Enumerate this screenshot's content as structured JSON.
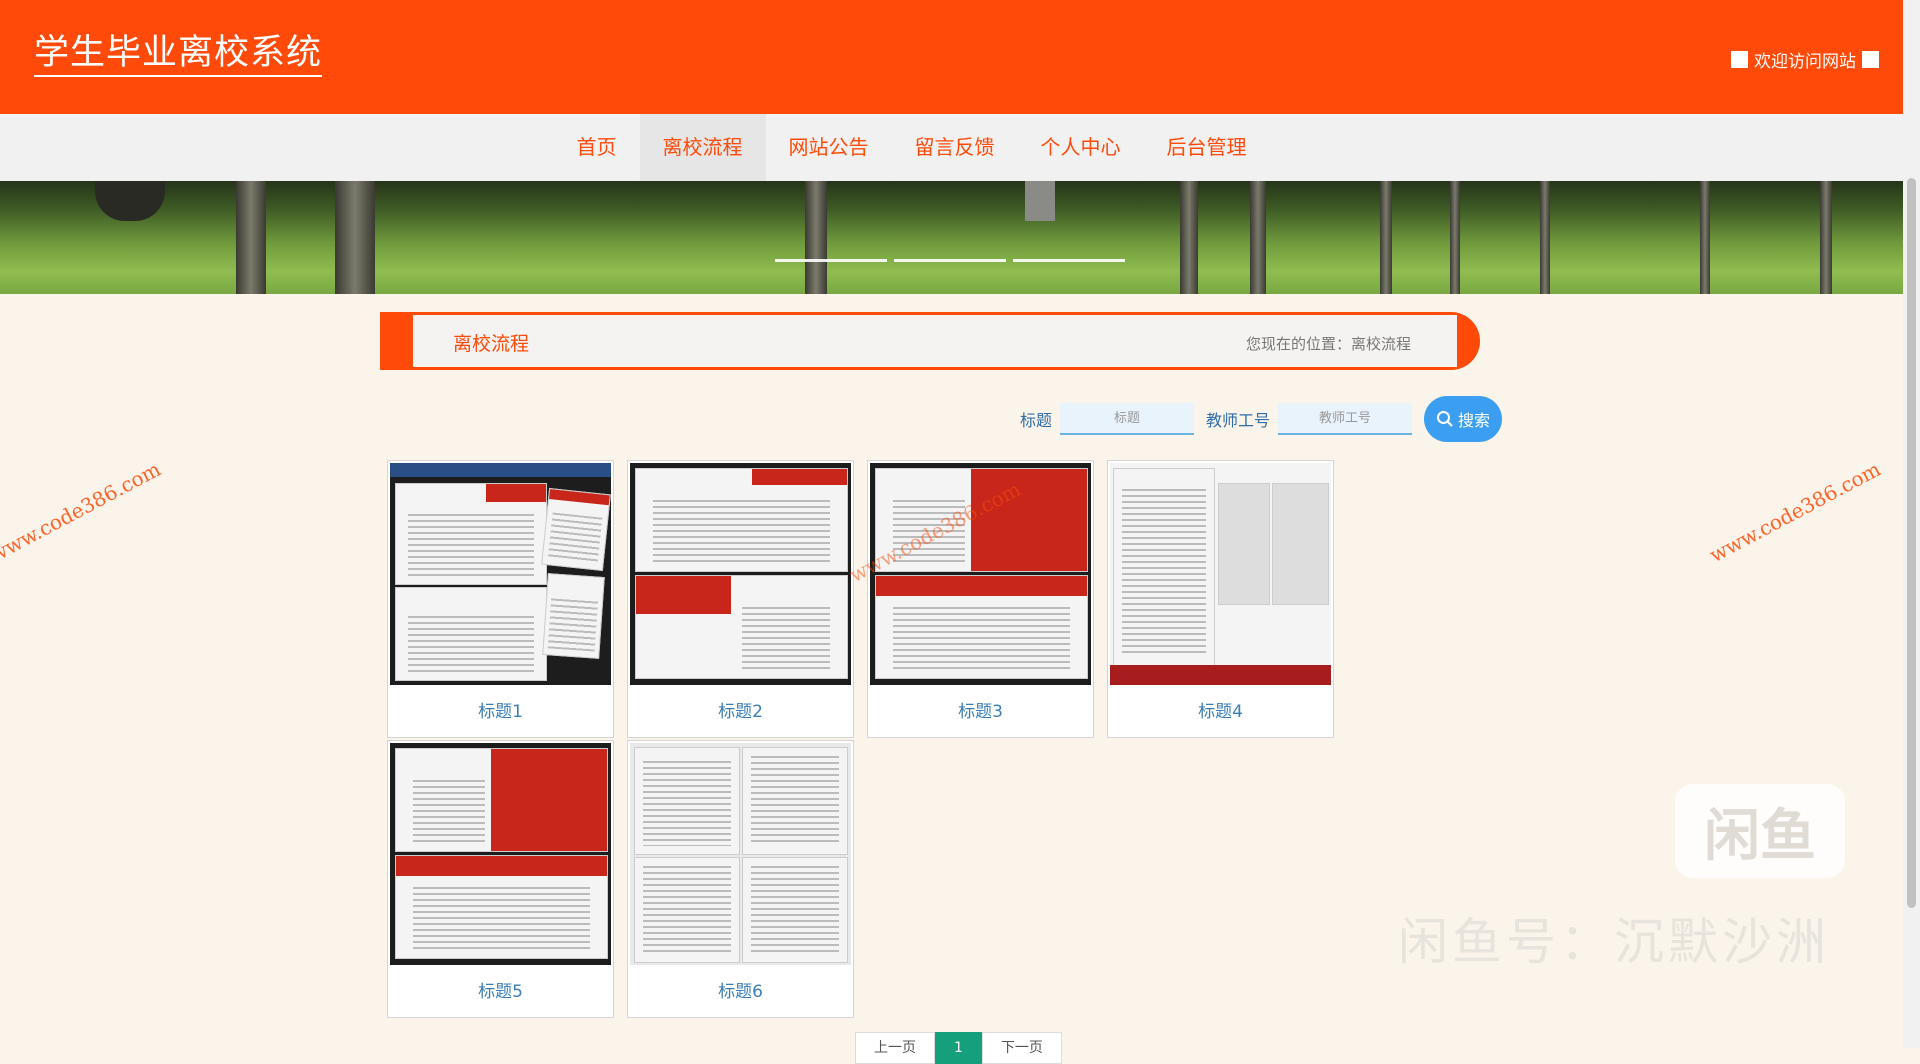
{
  "header": {
    "title": "学生毕业离校系统",
    "welcome": "欢迎访问网站"
  },
  "nav": {
    "items": [
      "首页",
      "离校流程",
      "网站公告",
      "留言反馈",
      "个人中心",
      "后台管理"
    ],
    "active_index": 1
  },
  "crumb": {
    "title": "离校流程",
    "position": "您现在的位置：离校流程"
  },
  "search": {
    "title_label": "标题",
    "title_placeholder": "标题",
    "teacher_label": "教师工号",
    "teacher_placeholder": "教师工号",
    "button": "搜索"
  },
  "cards": [
    {
      "title": "标题1"
    },
    {
      "title": "标题2"
    },
    {
      "title": "标题3"
    },
    {
      "title": "标题4"
    },
    {
      "title": "标题5"
    },
    {
      "title": "标题6"
    }
  ],
  "pager": {
    "prev": "上一页",
    "current": "1",
    "next": "下一页"
  },
  "watermarks": {
    "site": "www.code386.com",
    "xianyu_logo": "闲鱼",
    "xianyu_id": "闲鱼号：沉默沙洲"
  },
  "colors": {
    "brand": "#ff4a09",
    "link": "#3b7fb6",
    "search_button": "#3b9ef0",
    "pager_current": "#159f7a"
  }
}
